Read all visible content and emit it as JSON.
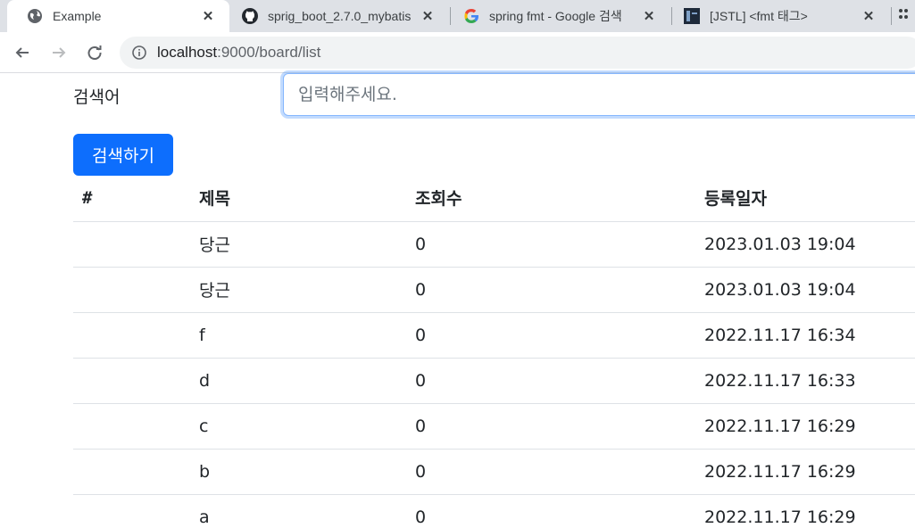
{
  "browser": {
    "tabs": [
      {
        "title": "Example",
        "icon": "globe-icon",
        "active": true
      },
      {
        "title": "sprig_boot_2.7.0_mybatis",
        "icon": "github-icon",
        "active": false
      },
      {
        "title": "spring fmt - Google 검색",
        "icon": "google-icon",
        "active": false
      },
      {
        "title": "[JSTL] <fmt 태그>",
        "icon": "site-favicon",
        "active": false
      }
    ],
    "url_host": "localhost",
    "url_path": ":9000/board/list"
  },
  "search": {
    "label": "검색어",
    "placeholder": "입력해주세요.",
    "value": "",
    "button_label": "검색하기"
  },
  "table": {
    "headers": [
      "#",
      "제목",
      "조회수",
      "등록일자"
    ],
    "rows": [
      {
        "no": "",
        "title": "당근",
        "views": "0",
        "date": "2023.01.03 19:04"
      },
      {
        "no": "",
        "title": "당근",
        "views": "0",
        "date": "2023.01.03 19:04"
      },
      {
        "no": "",
        "title": "f",
        "views": "0",
        "date": "2022.11.17 16:34"
      },
      {
        "no": "",
        "title": "d",
        "views": "0",
        "date": "2022.11.17 16:33"
      },
      {
        "no": "",
        "title": "c",
        "views": "0",
        "date": "2022.11.17 16:29"
      },
      {
        "no": "",
        "title": "b",
        "views": "0",
        "date": "2022.11.17 16:29"
      },
      {
        "no": "",
        "title": "a",
        "views": "0",
        "date": "2022.11.17 16:29"
      }
    ]
  },
  "colors": {
    "primary": "#0d6efd",
    "tabstrip": "#dee1e6",
    "omnibox": "#f1f3f4",
    "row_border": "#dee2e6"
  }
}
